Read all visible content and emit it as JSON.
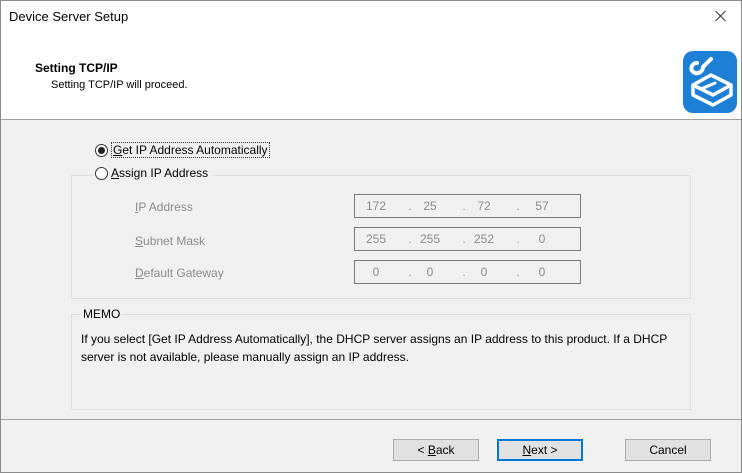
{
  "window": {
    "title": "Device Server Setup"
  },
  "header": {
    "title": "Setting TCP/IP",
    "subtitle": "Setting TCP/IP will proceed."
  },
  "options": {
    "auto": {
      "pre": "",
      "accel": "G",
      "rest": "et IP Address Automatically",
      "selected": true
    },
    "assign": {
      "pre": "",
      "accel": "A",
      "rest": "ssign IP Address",
      "selected": false
    }
  },
  "fields": {
    "ip": {
      "pre": "",
      "accel": "I",
      "rest": "P Address",
      "octets": [
        "172",
        "25",
        "72",
        "57"
      ]
    },
    "subnet": {
      "pre": "",
      "accel": "S",
      "rest": "ubnet Mask",
      "octets": [
        "255",
        "255",
        "252",
        "0"
      ]
    },
    "gateway": {
      "pre": "",
      "accel": "D",
      "rest": "efault Gateway",
      "octets": [
        "0",
        "0",
        "0",
        "0"
      ]
    }
  },
  "memo": {
    "label": "MEMO",
    "text": "If you select [Get IP Address Automatically], the DHCP server assigns an IP address to this product. If a DHCP server is not available, please manually assign an IP address."
  },
  "buttons": {
    "back": {
      "pre": "< ",
      "accel": "B",
      "rest": "ack"
    },
    "next": {
      "pre": "",
      "accel": "N",
      "rest": "ext >"
    },
    "cancel": {
      "label": "Cancel"
    }
  },
  "colors": {
    "accent": "#0078d7",
    "icon": "#1e7fd6"
  },
  "icons": {
    "header": "network-settings-icon",
    "close": "close-icon"
  }
}
